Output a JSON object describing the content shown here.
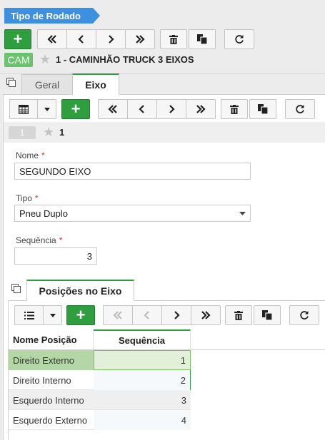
{
  "header": {
    "title_tag": "Tipo de Rodado",
    "badge": "CAM",
    "record_title": "1 - CAMINHÃO TRUCK 3 EIXOS"
  },
  "tabs": [
    {
      "label": "Geral"
    },
    {
      "label": "Eixo"
    }
  ],
  "eixo": {
    "record_badge": "1",
    "record_title": "1",
    "form": {
      "nome_label": "Nome",
      "nome_value": "SEGUNDO EIXO",
      "tipo_label": "Tipo",
      "tipo_value": "Pneu Duplo",
      "sequencia_label": "Sequência",
      "sequencia_value": "3",
      "required_mark": "*"
    }
  },
  "subtab": {
    "label": "Posições no Eixo"
  },
  "grid": {
    "columns": [
      "Nome Posição",
      "Sequência"
    ],
    "rows": [
      {
        "nome": "Direito Externo",
        "seq": "1"
      },
      {
        "nome": "Direito Interno",
        "seq": "2"
      },
      {
        "nome": "Esquerdo Interno",
        "seq": "3"
      },
      {
        "nome": "Esquerdo Externo",
        "seq": "4"
      }
    ]
  },
  "icons": {
    "add": "+",
    "first": "double-chevron-left-icon",
    "prev": "chevron-left-icon",
    "next": "chevron-right-icon",
    "last": "double-chevron-right-icon",
    "delete": "trash-icon",
    "copy": "copy-icon",
    "refresh": "refresh-icon",
    "star": "star-icon",
    "calendar": "calendar-icon",
    "list": "list-icon",
    "dropdown": "caret-down-icon",
    "panel": "panel-toggle-icon"
  },
  "colors": {
    "accent_blue": "#3d8fe0",
    "green": "#2e9e3e",
    "badge_green": "#6cc36f",
    "selected_row": "#b5d7a8"
  }
}
